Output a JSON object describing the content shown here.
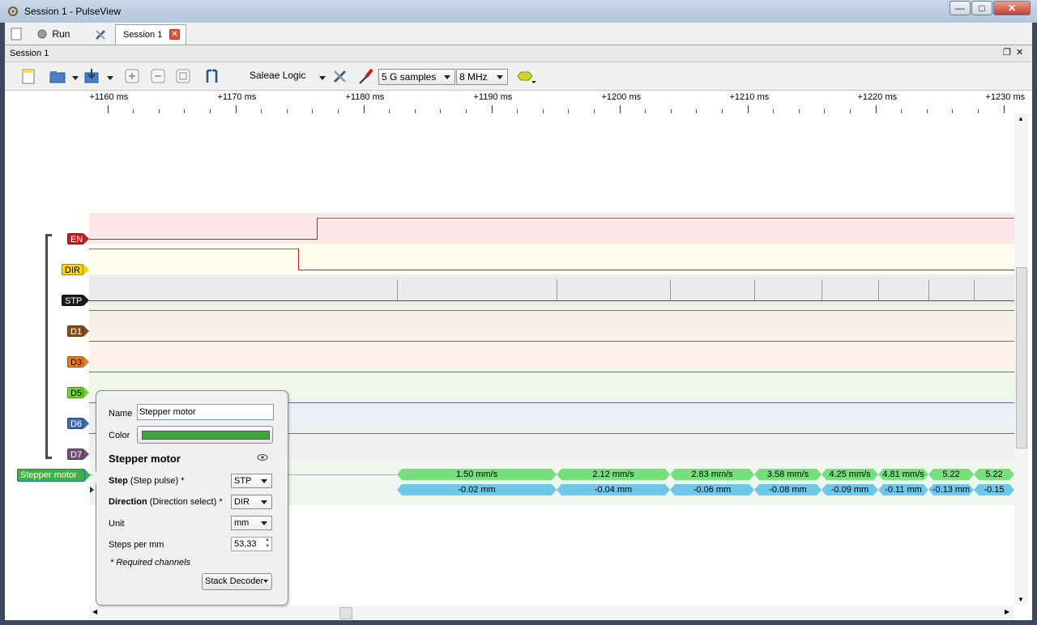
{
  "window": {
    "title": "Session 1 - PulseView",
    "minimize": "—",
    "maximize": "□",
    "close": "✕"
  },
  "tabbar": {
    "run_label": "Run",
    "session_tab": "Session 1",
    "session_tab_close": "✕"
  },
  "dock": {
    "title": "Session 1",
    "float": "❐",
    "close": "✕"
  },
  "toolbar": {
    "device": "Saleae Logic",
    "samples": "5 G samples",
    "samplerate": "8 MHz"
  },
  "ruler": {
    "labels": [
      "+1160 ms",
      "+1170 ms",
      "+1180 ms",
      "+1190 ms",
      "+1200 ms",
      "+1210 ms",
      "+1220 ms",
      "+1230 ms"
    ]
  },
  "channels": [
    {
      "name": "EN",
      "color": "#cc1b1b",
      "text": "#ffffff"
    },
    {
      "name": "DIR",
      "color": "#f5d40f",
      "text": "#000000"
    },
    {
      "name": "STP",
      "color": "#1a1a1a",
      "text": "#ffffff"
    },
    {
      "name": "D1",
      "color": "#8b4b13",
      "text": "#ffffff"
    },
    {
      "name": "D3",
      "color": "#f07b1c",
      "text": "#000000"
    },
    {
      "name": "D5",
      "color": "#6fd62a",
      "text": "#000000"
    },
    {
      "name": "D6",
      "color": "#3b6bb5",
      "text": "#ffffff"
    },
    {
      "name": "D7",
      "color": "#75507b",
      "text": "#ffffff"
    }
  ],
  "decoder": {
    "label": "Stepper motor",
    "speed_row": [
      "1.50 mm/s",
      "2.12 mm/s",
      "2.83 mm/s",
      "3.58 mm/s",
      "4.25 mm/s",
      "4.81 mm/s",
      "5.22",
      "5.22"
    ],
    "position_row": [
      "-0.02 mm",
      "-0.04 mm",
      "-0.06 mm",
      "-0.08 mm",
      "-0.09 mm",
      "-0.11 mm",
      "-0.13 mm",
      "-0.15"
    ]
  },
  "popup": {
    "name_label": "Name",
    "name_value": "Stepper motor",
    "color_label": "Color",
    "color_value": "#33aa33",
    "heading": "Stepper motor",
    "step_bold": "Step",
    "step_desc": " (Step pulse) *",
    "step_value": "STP",
    "direction_bold": "Direction",
    "direction_desc": " (Direction select) *",
    "direction_value": "DIR",
    "unit_label": "Unit",
    "unit_value": "mm",
    "steps_label": "Steps per mm",
    "steps_value": "53,33",
    "required_note": "* Required channels",
    "stack_button": "Stack Decoder"
  },
  "colors": {
    "signal_low": "#c81e1e",
    "signal_high": "#22aa22",
    "speed_segment": "#74e07a",
    "position_segment": "#6ec6e8"
  }
}
